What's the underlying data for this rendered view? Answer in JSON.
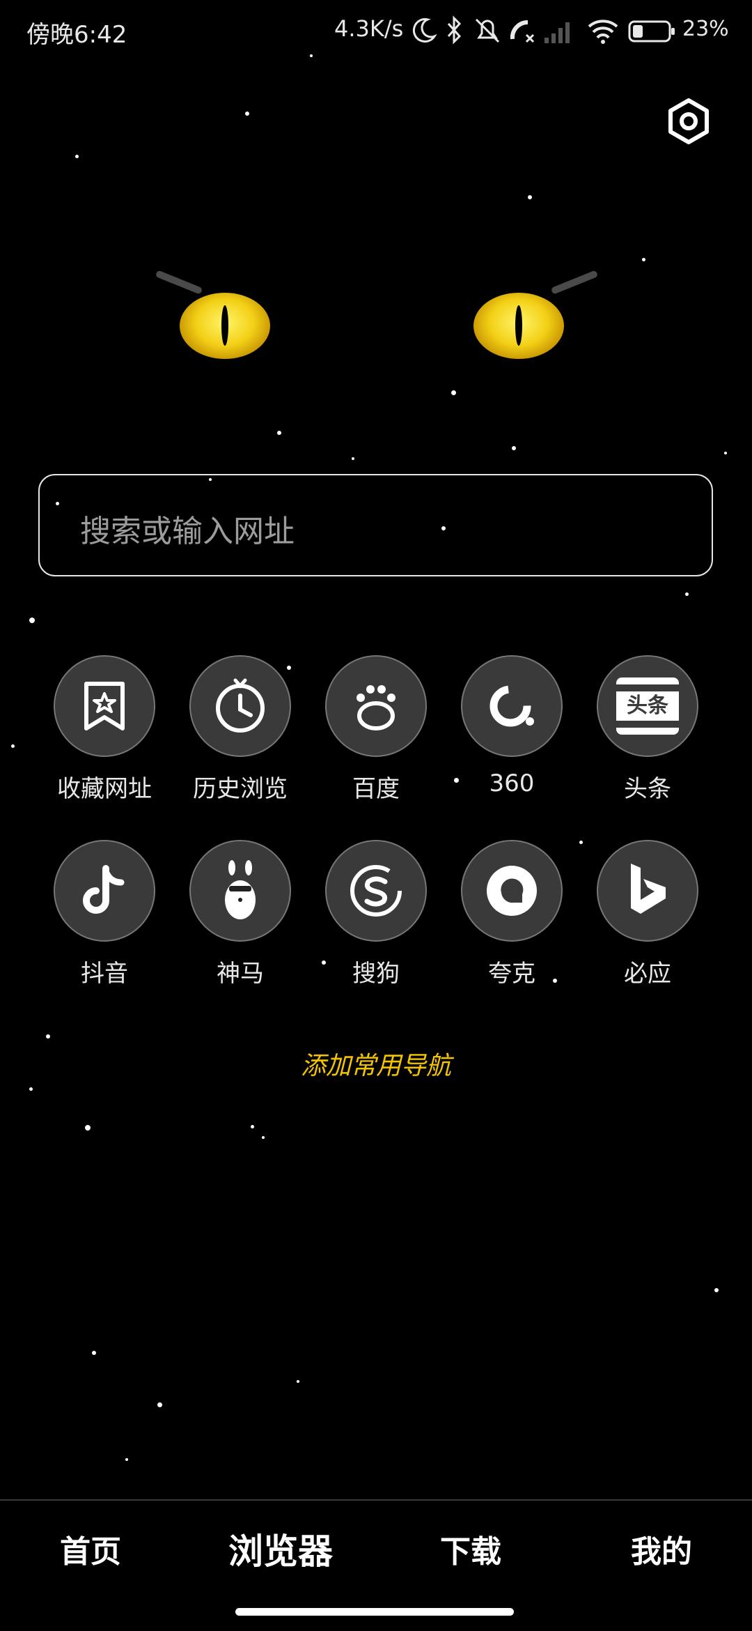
{
  "status_bar": {
    "time": "傍晚6:42",
    "speed": "4.3K/s",
    "battery": "23%"
  },
  "search": {
    "placeholder": "搜索或输入网址"
  },
  "shortcuts": [
    {
      "label": "收藏网址",
      "icon": "bookmark-star-icon"
    },
    {
      "label": "历史浏览",
      "icon": "history-clock-icon"
    },
    {
      "label": "百度",
      "icon": "baidu-paw-icon"
    },
    {
      "label": "360",
      "icon": "360-icon"
    },
    {
      "label": "头条",
      "icon": "toutiao-icon"
    },
    {
      "label": "抖音",
      "icon": "douyin-icon"
    },
    {
      "label": "神马",
      "icon": "shenma-alpaca-icon"
    },
    {
      "label": "搜狗",
      "icon": "sogou-icon"
    },
    {
      "label": "夸克",
      "icon": "quark-icon"
    },
    {
      "label": "必应",
      "icon": "bing-icon"
    }
  ],
  "toutiao_icon_text": "头条",
  "add_nav_label": "添加常用导航",
  "bottom_nav": {
    "home": "首页",
    "browser": "浏览器",
    "download": "下载",
    "mine": "我的"
  },
  "colors": {
    "background": "#000000",
    "accent": "#f5c400",
    "eye": "#f3d016"
  }
}
